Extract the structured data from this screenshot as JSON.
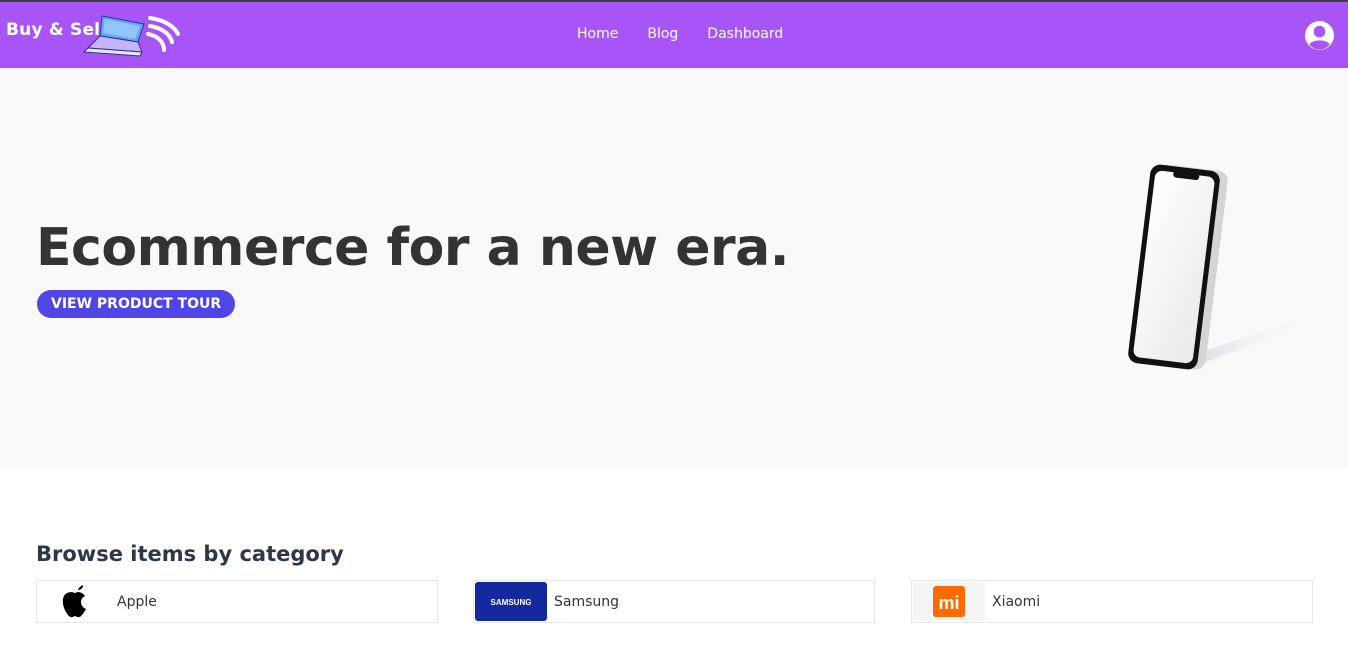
{
  "header": {
    "logo_text": "Buy & Sell",
    "nav": [
      {
        "label": "Home"
      },
      {
        "label": "Blog"
      },
      {
        "label": "Dashboard"
      }
    ]
  },
  "hero": {
    "title": "Ecommerce for a new era.",
    "cta_label": "VIEW PRODUCT TOUR"
  },
  "categories": {
    "title": "Browse items by category",
    "items": [
      {
        "label": "Apple",
        "icon": "apple-logo-icon"
      },
      {
        "label": "Samsung",
        "icon": "samsung-logo-icon",
        "logo_text": "SAMSUNG"
      },
      {
        "label": "Xiaomi",
        "icon": "xiaomi-logo-icon",
        "logo_text": "mi"
      }
    ]
  },
  "colors": {
    "navbar": "#a855f7",
    "button": "#4f46e5",
    "hero_bg": "#f9f9f9",
    "samsung_blue": "#1428a0",
    "xiaomi_orange": "#ff6900"
  }
}
